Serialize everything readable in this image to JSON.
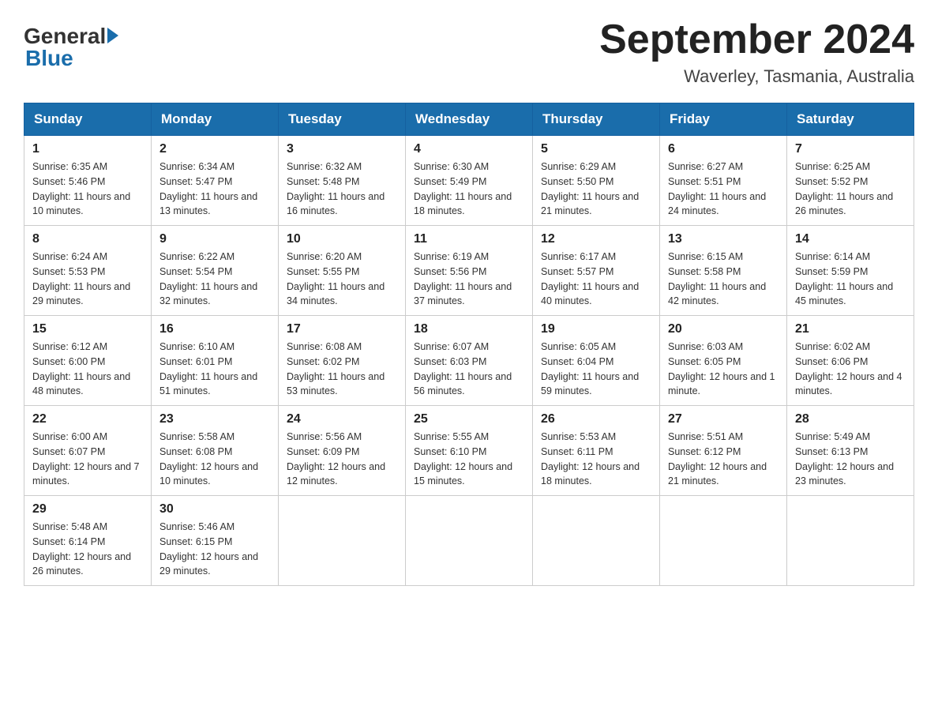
{
  "logo": {
    "general": "General",
    "blue": "Blue"
  },
  "title": "September 2024",
  "location": "Waverley, Tasmania, Australia",
  "headers": [
    "Sunday",
    "Monday",
    "Tuesday",
    "Wednesday",
    "Thursday",
    "Friday",
    "Saturday"
  ],
  "weeks": [
    [
      {
        "day": "1",
        "sunrise": "6:35 AM",
        "sunset": "5:46 PM",
        "daylight": "11 hours and 10 minutes."
      },
      {
        "day": "2",
        "sunrise": "6:34 AM",
        "sunset": "5:47 PM",
        "daylight": "11 hours and 13 minutes."
      },
      {
        "day": "3",
        "sunrise": "6:32 AM",
        "sunset": "5:48 PM",
        "daylight": "11 hours and 16 minutes."
      },
      {
        "day": "4",
        "sunrise": "6:30 AM",
        "sunset": "5:49 PM",
        "daylight": "11 hours and 18 minutes."
      },
      {
        "day": "5",
        "sunrise": "6:29 AM",
        "sunset": "5:50 PM",
        "daylight": "11 hours and 21 minutes."
      },
      {
        "day": "6",
        "sunrise": "6:27 AM",
        "sunset": "5:51 PM",
        "daylight": "11 hours and 24 minutes."
      },
      {
        "day": "7",
        "sunrise": "6:25 AM",
        "sunset": "5:52 PM",
        "daylight": "11 hours and 26 minutes."
      }
    ],
    [
      {
        "day": "8",
        "sunrise": "6:24 AM",
        "sunset": "5:53 PM",
        "daylight": "11 hours and 29 minutes."
      },
      {
        "day": "9",
        "sunrise": "6:22 AM",
        "sunset": "5:54 PM",
        "daylight": "11 hours and 32 minutes."
      },
      {
        "day": "10",
        "sunrise": "6:20 AM",
        "sunset": "5:55 PM",
        "daylight": "11 hours and 34 minutes."
      },
      {
        "day": "11",
        "sunrise": "6:19 AM",
        "sunset": "5:56 PM",
        "daylight": "11 hours and 37 minutes."
      },
      {
        "day": "12",
        "sunrise": "6:17 AM",
        "sunset": "5:57 PM",
        "daylight": "11 hours and 40 minutes."
      },
      {
        "day": "13",
        "sunrise": "6:15 AM",
        "sunset": "5:58 PM",
        "daylight": "11 hours and 42 minutes."
      },
      {
        "day": "14",
        "sunrise": "6:14 AM",
        "sunset": "5:59 PM",
        "daylight": "11 hours and 45 minutes."
      }
    ],
    [
      {
        "day": "15",
        "sunrise": "6:12 AM",
        "sunset": "6:00 PM",
        "daylight": "11 hours and 48 minutes."
      },
      {
        "day": "16",
        "sunrise": "6:10 AM",
        "sunset": "6:01 PM",
        "daylight": "11 hours and 51 minutes."
      },
      {
        "day": "17",
        "sunrise": "6:08 AM",
        "sunset": "6:02 PM",
        "daylight": "11 hours and 53 minutes."
      },
      {
        "day": "18",
        "sunrise": "6:07 AM",
        "sunset": "6:03 PM",
        "daylight": "11 hours and 56 minutes."
      },
      {
        "day": "19",
        "sunrise": "6:05 AM",
        "sunset": "6:04 PM",
        "daylight": "11 hours and 59 minutes."
      },
      {
        "day": "20",
        "sunrise": "6:03 AM",
        "sunset": "6:05 PM",
        "daylight": "12 hours and 1 minute."
      },
      {
        "day": "21",
        "sunrise": "6:02 AM",
        "sunset": "6:06 PM",
        "daylight": "12 hours and 4 minutes."
      }
    ],
    [
      {
        "day": "22",
        "sunrise": "6:00 AM",
        "sunset": "6:07 PM",
        "daylight": "12 hours and 7 minutes."
      },
      {
        "day": "23",
        "sunrise": "5:58 AM",
        "sunset": "6:08 PM",
        "daylight": "12 hours and 10 minutes."
      },
      {
        "day": "24",
        "sunrise": "5:56 AM",
        "sunset": "6:09 PM",
        "daylight": "12 hours and 12 minutes."
      },
      {
        "day": "25",
        "sunrise": "5:55 AM",
        "sunset": "6:10 PM",
        "daylight": "12 hours and 15 minutes."
      },
      {
        "day": "26",
        "sunrise": "5:53 AM",
        "sunset": "6:11 PM",
        "daylight": "12 hours and 18 minutes."
      },
      {
        "day": "27",
        "sunrise": "5:51 AM",
        "sunset": "6:12 PM",
        "daylight": "12 hours and 21 minutes."
      },
      {
        "day": "28",
        "sunrise": "5:49 AM",
        "sunset": "6:13 PM",
        "daylight": "12 hours and 23 minutes."
      }
    ],
    [
      {
        "day": "29",
        "sunrise": "5:48 AM",
        "sunset": "6:14 PM",
        "daylight": "12 hours and 26 minutes."
      },
      {
        "day": "30",
        "sunrise": "5:46 AM",
        "sunset": "6:15 PM",
        "daylight": "12 hours and 29 minutes."
      },
      null,
      null,
      null,
      null,
      null
    ]
  ]
}
